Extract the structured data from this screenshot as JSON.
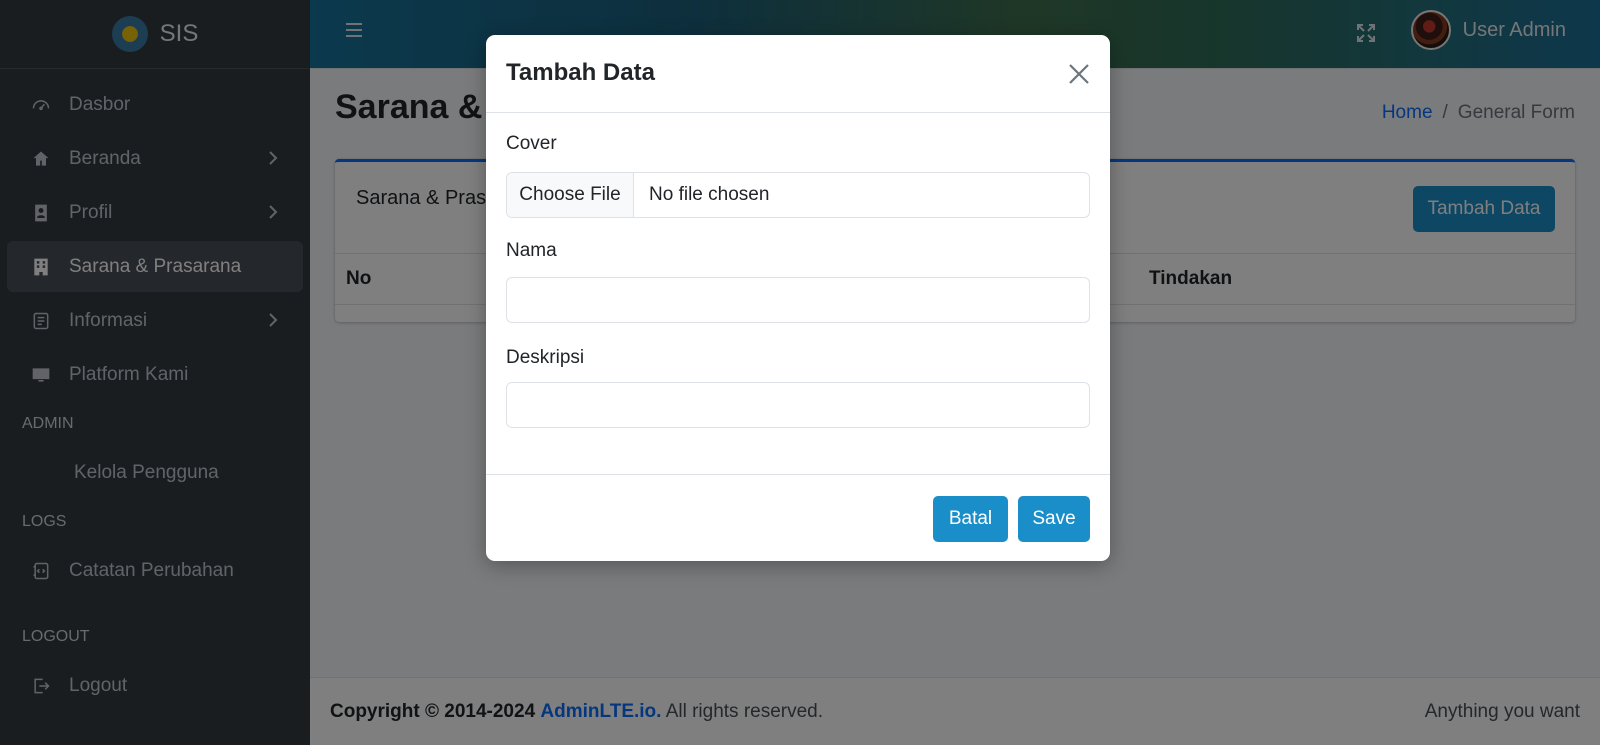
{
  "brand": {
    "name": "SIS"
  },
  "sidebar": {
    "items": [
      {
        "label": "Dasbor",
        "icon": "dashboard-icon"
      },
      {
        "label": "Beranda",
        "icon": "home-icon"
      },
      {
        "label": "Profil",
        "icon": "profile-icon"
      },
      {
        "label": "Sarana & Prasarana",
        "icon": "building-icon",
        "active": true
      },
      {
        "label": "Informasi",
        "icon": "info-list-icon"
      },
      {
        "label": "Platform Kami",
        "icon": "monitor-icon"
      }
    ],
    "admin_header": "ADMIN",
    "admin_items": [
      {
        "label": "Kelola Pengguna"
      }
    ],
    "logs_header": "LOGS",
    "logs_items": [
      {
        "label": "Catatan Perubahan",
        "icon": "code-file-icon"
      }
    ],
    "logout_header": "LOGOUT",
    "logout_items": [
      {
        "label": "Logout",
        "icon": "logout-icon"
      }
    ]
  },
  "topbar": {
    "user_name": "User Admin"
  },
  "page": {
    "title": "Sarana & Prasarana",
    "breadcrumb": {
      "home": "Home",
      "separator": "/",
      "current": "General Form"
    }
  },
  "card": {
    "title": "Sarana & Prasarana",
    "add_button": "Tambah Data",
    "columns": {
      "no": "No",
      "tindakan": "Tindakan"
    }
  },
  "footer": {
    "copyright": "Copyright © 2014-2024",
    "link": "AdminLTE.io.",
    "rights": "All rights reserved.",
    "right_text": "Anything you want"
  },
  "modal": {
    "title": "Tambah Data",
    "fields": {
      "cover_label": "Cover",
      "file_button": "Choose File",
      "file_status": "No file chosen",
      "nama_label": "Nama",
      "nama_value": "",
      "deskripsi_label": "Deskripsi",
      "deskripsi_value": ""
    },
    "buttons": {
      "cancel": "Batal",
      "save": "Save"
    }
  },
  "colors": {
    "sidebar_bg": "#343a40",
    "primary_button": "#1a8ec8",
    "link": "#0d6efd"
  }
}
